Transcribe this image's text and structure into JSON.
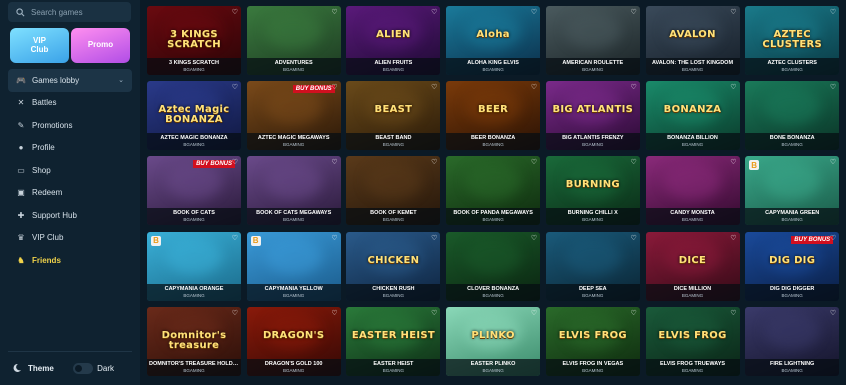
{
  "sidebar": {
    "search_placeholder": "Search games",
    "vip_button": "VIP\nClub",
    "promo_button": "Promo",
    "items": [
      {
        "label": "Games lobby",
        "icon": "gamepad-icon",
        "active": true
      },
      {
        "label": "Battles",
        "icon": "crossed-swords-icon"
      },
      {
        "label": "Promotions",
        "icon": "tag-icon"
      },
      {
        "label": "Profile",
        "icon": "user-icon"
      },
      {
        "label": "Shop",
        "icon": "cart-icon"
      },
      {
        "label": "Redeem",
        "icon": "redeem-icon"
      },
      {
        "label": "Support Hub",
        "icon": "support-icon"
      },
      {
        "label": "VIP Club",
        "icon": "crown-icon"
      },
      {
        "label": "Friends",
        "icon": "friends-icon",
        "highlight": "#f0d24a"
      }
    ],
    "theme_label": "Theme",
    "theme_value": "Dark"
  },
  "games": [
    {
      "name": "3 KINGS SCRATCH",
      "provider": "BGAMING",
      "logo": "3 KINGS\nSCRATCH",
      "c1": "#6a0a10",
      "c2": "#2a0406"
    },
    {
      "name": "ADVENTURES",
      "provider": "BGAMING",
      "logo": "",
      "c1": "#3a7a3e",
      "c2": "#1d3a22"
    },
    {
      "name": "ALIEN FRUITS",
      "provider": "BGAMING",
      "logo": "ALIEN",
      "c1": "#5a1a7a",
      "c2": "#1e0a33"
    },
    {
      "name": "ALOHA KING ELVIS",
      "provider": "BGAMING",
      "logo": "Aloha",
      "c1": "#1a7a9a",
      "c2": "#0b2e4a"
    },
    {
      "name": "AMERICAN ROULETTE",
      "provider": "BGAMING",
      "logo": "",
      "c1": "#4a5a5e",
      "c2": "#1a2326"
    },
    {
      "name": "AVALON: THE LOST KINGDOM",
      "provider": "BGAMING",
      "logo": "AVALON",
      "c1": "#3a4a5a",
      "c2": "#151e28"
    },
    {
      "name": "AZTEC CLUSTERS",
      "provider": "BGAMING",
      "logo": "AZTEC\nCLUSTERS",
      "c1": "#1a7a8a",
      "c2": "#0a3a44"
    },
    {
      "name": "AZTEC MAGIC BONANZA",
      "provider": "BGAMING",
      "logo": "Aztec Magic\nBONANZA",
      "c1": "#2a3a8a",
      "c2": "#101840"
    },
    {
      "name": "AZTEC MAGIC MEGAWAYS",
      "provider": "BGAMING",
      "logo": "",
      "badge": "BUY BONUS",
      "c1": "#7a4a1a",
      "c2": "#2a1808"
    },
    {
      "name": "BEAST BAND",
      "provider": "BGAMING",
      "logo": "BEAST",
      "c1": "#6a4a1a",
      "c2": "#2a1a08"
    },
    {
      "name": "BEER BONANZA",
      "provider": "BGAMING",
      "logo": "BEER",
      "c1": "#7a3a0a",
      "c2": "#2a1204"
    },
    {
      "name": "BIG ATLANTIS FRENZY",
      "provider": "BGAMING",
      "logo": "BIG ATLANTIS",
      "c1": "#7a2a8a",
      "c2": "#2a0a33"
    },
    {
      "name": "BONANZA BILLION",
      "provider": "BGAMING",
      "logo": "BONANZA",
      "c1": "#1a8a6a",
      "c2": "#0a3a2a"
    },
    {
      "name": "BONE BONANZA",
      "provider": "BGAMING",
      "logo": "",
      "c1": "#1a7a5a",
      "c2": "#0a3326"
    },
    {
      "name": "BOOK OF CATS",
      "provider": "BGAMING",
      "logo": "",
      "badge": "BUY BONUS",
      "c1": "#6a4a8a",
      "c2": "#2a1a3a"
    },
    {
      "name": "BOOK OF CATS MEGAWAYS",
      "provider": "BGAMING",
      "logo": "",
      "c1": "#6a4a8a",
      "c2": "#2a1a3a"
    },
    {
      "name": "BOOK OF KEMET",
      "provider": "BGAMING",
      "logo": "",
      "c1": "#5a3a1a",
      "c2": "#24160a"
    },
    {
      "name": "BOOK OF PANDA MEGAWAYS",
      "provider": "BGAMING",
      "logo": "",
      "c1": "#2a6a2a",
      "c2": "#0e2a0e"
    },
    {
      "name": "BURNING CHILLI X",
      "provider": "BGAMING",
      "logo": "BURNING",
      "c1": "#1a6a3a",
      "c2": "#0a2a16"
    },
    {
      "name": "CANDY MONSTA",
      "provider": "BGAMING",
      "logo": "",
      "c1": "#8a2a7a",
      "c2": "#330a2e"
    },
    {
      "name": "CAPYMANIA GREEN",
      "provider": "BGAMING",
      "logo": "",
      "bmark": true,
      "c1": "#3aa88a",
      "c2": "#1a5a48"
    },
    {
      "name": "CAPYMANIA ORANGE",
      "provider": "BGAMING",
      "logo": "",
      "bmark": true,
      "c1": "#3ab0d8",
      "c2": "#1a6a8a"
    },
    {
      "name": "CAPYMANIA YELLOW",
      "provider": "BGAMING",
      "logo": "",
      "bmark": true,
      "c1": "#3a9ad8",
      "c2": "#1a5a8a"
    },
    {
      "name": "CHICKEN RUSH",
      "provider": "BGAMING",
      "logo": "CHICKEN",
      "c1": "#2a5a8a",
      "c2": "#0e2440"
    },
    {
      "name": "CLOVER BONANZA",
      "provider": "BGAMING",
      "logo": "",
      "c1": "#1a5a2a",
      "c2": "#0a2410"
    },
    {
      "name": "DEEP SEA",
      "provider": "BGAMING",
      "logo": "",
      "c1": "#1a5a7a",
      "c2": "#0a2433"
    },
    {
      "name": "DICE MILLION",
      "provider": "BGAMING",
      "logo": "DICE",
      "c1": "#8a1a3a",
      "c2": "#330a16"
    },
    {
      "name": "DIG DIG DIGGER",
      "provider": "BGAMING",
      "logo": "DIG DIG",
      "badge": "BUY BONUS",
      "c1": "#1a4a9a",
      "c2": "#0a1e44"
    },
    {
      "name": "DOMNITOR'S TREASURE HOLD AND WIN",
      "provider": "BGAMING",
      "logo": "Domnitor's\ntreasure",
      "c1": "#6a2a1a",
      "c2": "#2a0e08"
    },
    {
      "name": "DRAGON'S GOLD 100",
      "provider": "BGAMING",
      "logo": "DRAGON'S",
      "c1": "#8a1a0a",
      "c2": "#330804"
    },
    {
      "name": "EASTER HEIST",
      "provider": "BGAMING",
      "logo": "EASTER HEIST",
      "c1": "#2a7a3a",
      "c2": "#0e2e16"
    },
    {
      "name": "EASTER PLINKO",
      "provider": "BGAMING",
      "logo": "PLINKO",
      "c1": "#8ad8b8",
      "c2": "#3a8a6a"
    },
    {
      "name": "ELVIS FROG IN VEGAS",
      "provider": "BGAMING",
      "logo": "ELVIS FROG",
      "c1": "#2a6a2a",
      "c2": "#0e2a0e"
    },
    {
      "name": "ELVIS FROG TRUEWAYS",
      "provider": "BGAMING",
      "logo": "ELVIS FROG",
      "c1": "#1a5a3a",
      "c2": "#0a2416"
    },
    {
      "name": "FIRE LIGHTNING",
      "provider": "BGAMING",
      "logo": "",
      "c1": "#3a3a6a",
      "c2": "#14142a"
    }
  ]
}
